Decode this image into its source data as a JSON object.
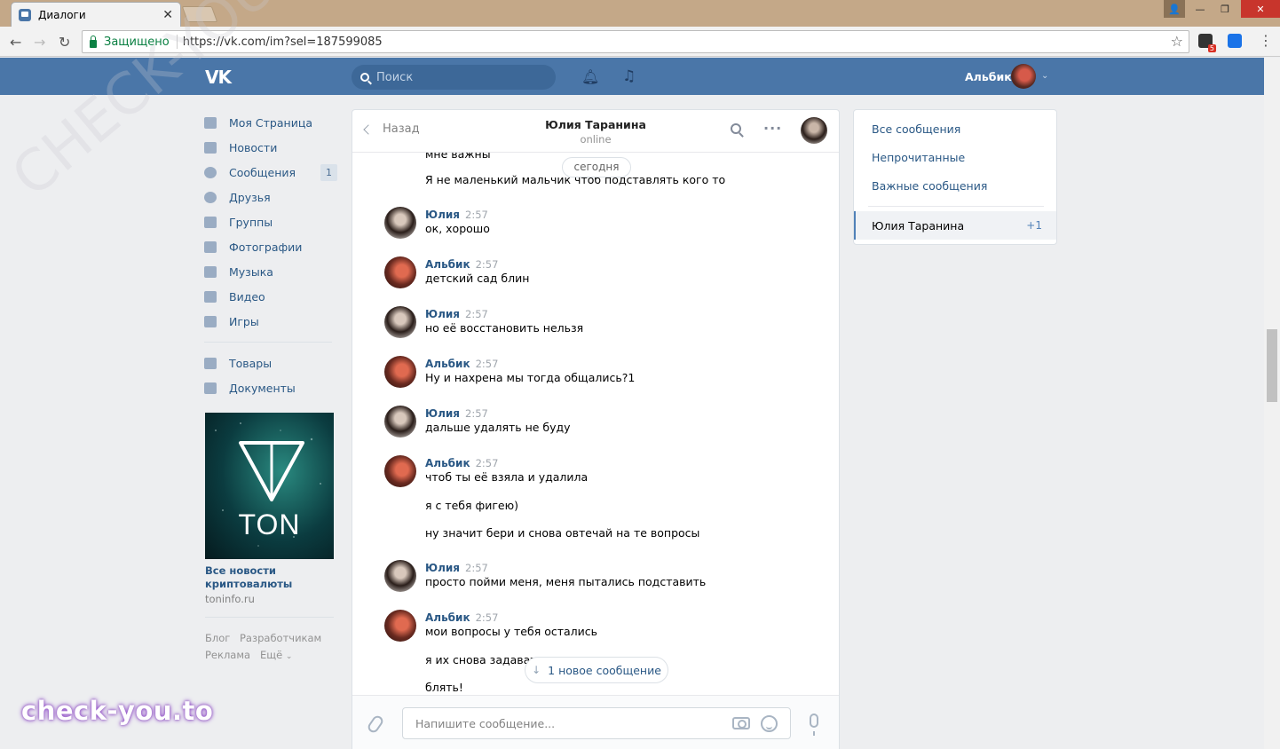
{
  "browser": {
    "tab_title": "Диалоги",
    "tab_close": "✕",
    "secure_label": "Защищено",
    "url": "https://vk.com/im?sel=187599085",
    "ext_badge": "5"
  },
  "header": {
    "logo": "VK",
    "search_placeholder": "Поиск",
    "user_name": "Альбик"
  },
  "sidebar": {
    "items": [
      {
        "label": "Моя Страница"
      },
      {
        "label": "Новости"
      },
      {
        "label": "Сообщения",
        "count": "1"
      },
      {
        "label": "Друзья"
      },
      {
        "label": "Группы"
      },
      {
        "label": "Фотографии"
      },
      {
        "label": "Музыка"
      },
      {
        "label": "Видео"
      },
      {
        "label": "Игры"
      },
      {
        "label": "Товары"
      },
      {
        "label": "Документы"
      }
    ],
    "ad": {
      "image_text": "TON",
      "title": "Все новости криптовалюты",
      "link": "toninfo.ru"
    },
    "footer": [
      "Блог",
      "Разработчикам",
      "Реклама",
      "Ещё"
    ]
  },
  "chat": {
    "back_label": "Назад",
    "peer_name": "Юлия Таранина",
    "peer_status": "online",
    "date_divider": "сегодня",
    "partial_top": "мне важны",
    "first_text": "Я не маленький мальчик чтоб подставлять кого то",
    "messages": [
      {
        "author": "Юлия",
        "time": "2:57",
        "text": "ок, хорошо"
      },
      {
        "author": "Альбик",
        "time": "2:57",
        "text": "детский сад блин"
      },
      {
        "author": "Юлия",
        "time": "2:57",
        "text": "но её восстановить нельзя"
      },
      {
        "author": "Альбик",
        "time": "2:57",
        "text": "Ну и нахрена мы тогда общались?1"
      },
      {
        "author": "Юлия",
        "time": "2:57",
        "text": "дальше удалять не буду"
      },
      {
        "author": "Альбик",
        "time": "2:57",
        "text": "чтоб ты её взяла и удалила"
      },
      {
        "author": "Юлия",
        "time": "2:57",
        "text": "просто пойми меня, меня пытались подставить"
      },
      {
        "author": "Альбик",
        "time": "2:57",
        "text": "мои вопросы у тебя остались"
      }
    ],
    "extra_lines": [
      "я с тебя фигею)",
      "ну значит бери и снова овтечай на те вопросы",
      "я их снова задавать",
      "блять!"
    ],
    "new_message_pill": "1 новое сообщение",
    "compose_placeholder": "Напишите сообщение..."
  },
  "filters": {
    "items": [
      "Все сообщения",
      "Непрочитанные",
      "Важные сообщения"
    ],
    "active_dialog": "Юлия Таранина",
    "active_count": "+1"
  },
  "watermarks": {
    "diagonal": "CHECK-YOU.ME",
    "brand": "check-you.to"
  }
}
